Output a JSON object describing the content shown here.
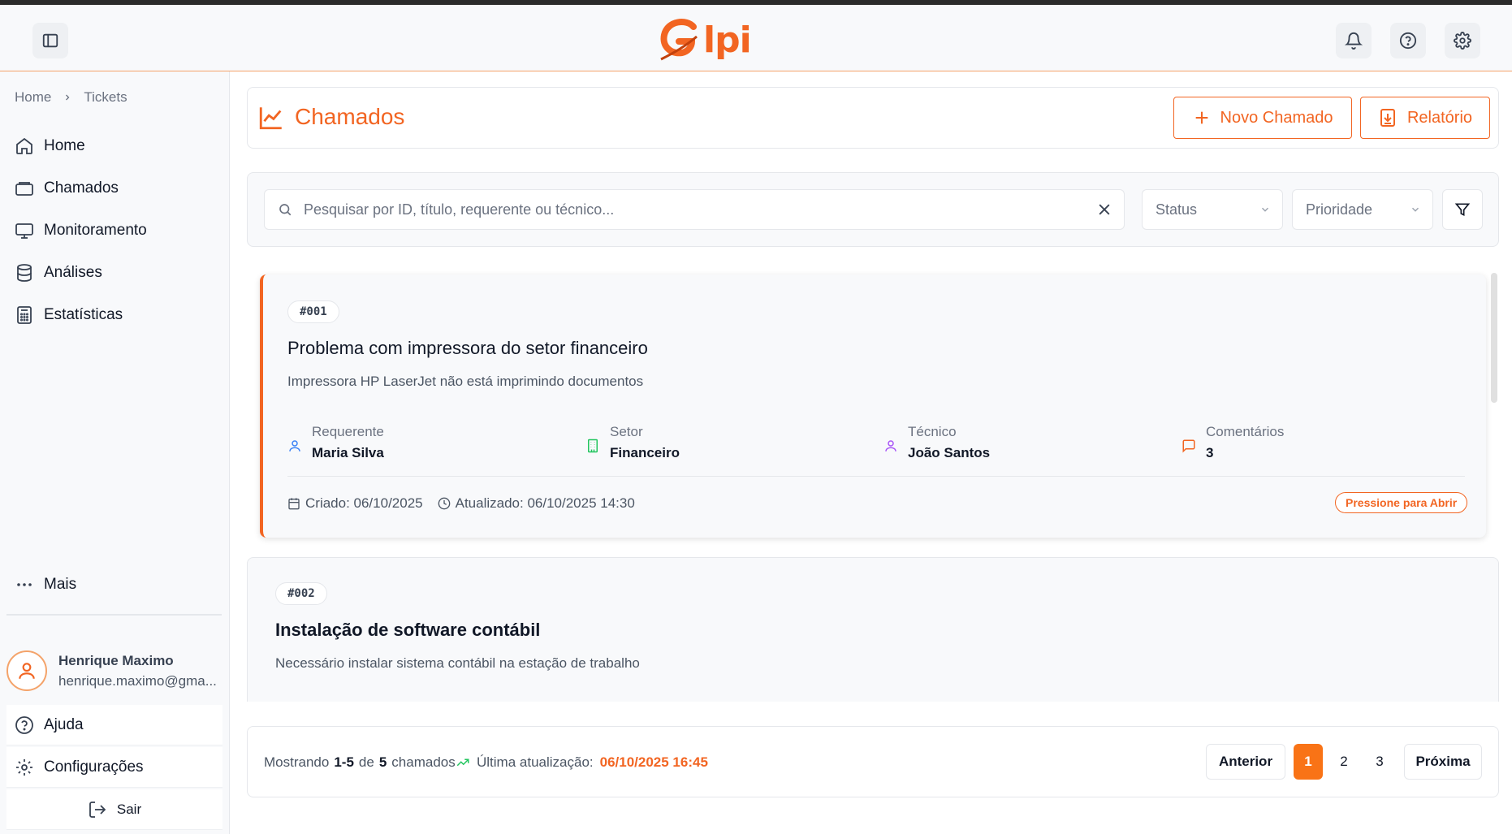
{
  "header": {
    "logo_text": "lpi",
    "logo_mark": "G",
    "accent_color": "#f26522"
  },
  "breadcrumb": {
    "home": "Home",
    "current": "Tickets"
  },
  "sidebar": {
    "items": [
      {
        "label": "Home",
        "icon": "home-icon"
      },
      {
        "label": "Chamados",
        "icon": "ticket-icon"
      },
      {
        "label": "Monitoramento",
        "icon": "monitor-icon"
      },
      {
        "label": "Análises",
        "icon": "database-icon"
      },
      {
        "label": "Estatísticas",
        "icon": "calculator-icon"
      }
    ],
    "more_label": "Mais",
    "user": {
      "name": "Henrique Maximo",
      "email": "henrique.maximo@gma..."
    },
    "help_label": "Ajuda",
    "settings_label": "Configurações",
    "logout_label": "Sair"
  },
  "page": {
    "title": "Chamados",
    "new_button": "Novo Chamado",
    "report_button": "Relatório"
  },
  "filters": {
    "search_placeholder": "Pesquisar por ID, título, requerente ou técnico...",
    "status_label": "Status",
    "priority_label": "Prioridade"
  },
  "tickets": [
    {
      "id": "#001",
      "title": "Problema com impressora do setor financeiro",
      "description": "Impressora HP LaserJet não está imprimindo documentos",
      "requester_label": "Requerente",
      "requester": "Maria Silva",
      "sector_label": "Setor",
      "sector": "Financeiro",
      "tech_label": "Técnico",
      "tech": "João Santos",
      "comments_label": "Comentários",
      "comments": "3",
      "created": "Criado: 06/10/2025",
      "updated": "Atualizado: 06/10/2025 14:30",
      "action": "Pressione para Abrir"
    },
    {
      "id": "#002",
      "title": "Instalação de software contábil",
      "description": "Necessário instalar sistema contábil na estação de trabalho"
    }
  ],
  "footer": {
    "showing_prefix": "Mostrando",
    "range": "1-5",
    "of": "de",
    "total": "5",
    "unit": "chamados",
    "last_update_label": "Última atualização:",
    "last_update_value": "06/10/2025 16:45",
    "prev": "Anterior",
    "pages": [
      "1",
      "2",
      "3"
    ],
    "next": "Próxima"
  }
}
